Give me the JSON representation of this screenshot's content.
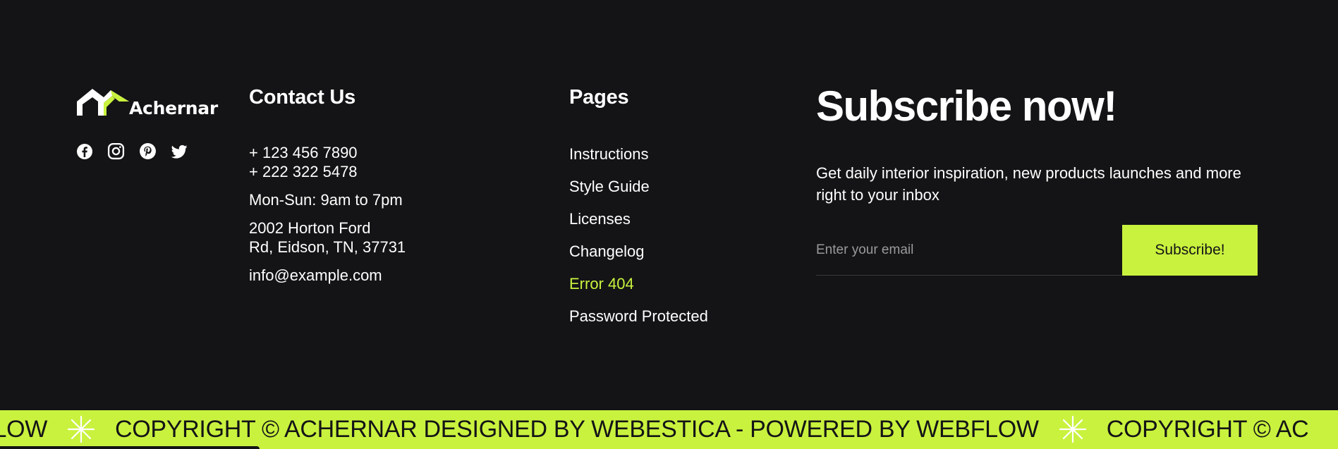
{
  "brand": {
    "name": "Achernar",
    "accent": "#c9f23e",
    "background": "#141416"
  },
  "socials": [
    {
      "name": "facebook-icon"
    },
    {
      "name": "instagram-icon"
    },
    {
      "name": "pinterest-icon"
    },
    {
      "name": "twitter-icon"
    }
  ],
  "contact": {
    "heading": "Contact Us",
    "phone1": "+ 123 456 7890",
    "phone2": "+ 222 322 5478",
    "hours": "Mon-Sun:  9am to 7pm",
    "address1": "2002 Horton Ford",
    "address2": "Rd, Eidson, TN, 37731",
    "email": "info@example.com"
  },
  "pages": {
    "heading": "Pages",
    "items": [
      {
        "label": "Instructions"
      },
      {
        "label": "Style Guide"
      },
      {
        "label": "Licenses"
      },
      {
        "label": "Changelog"
      },
      {
        "label": "Error 404",
        "active": true
      },
      {
        "label": "Password Protected"
      }
    ]
  },
  "subscribe": {
    "heading": "Subscribe now!",
    "description": "Get daily interior inspiration, new products launches and more right to your inbox",
    "placeholder": "Enter your email",
    "button": "Subscribe!"
  },
  "ticker": {
    "segment_a": "FLOW",
    "segment_b": "COPYRIGHT © ACHERNAR DESIGNED BY WEBESTICA - POWERED BY WEBFLOW",
    "segment_c": "COPYRIGHT © AC"
  }
}
